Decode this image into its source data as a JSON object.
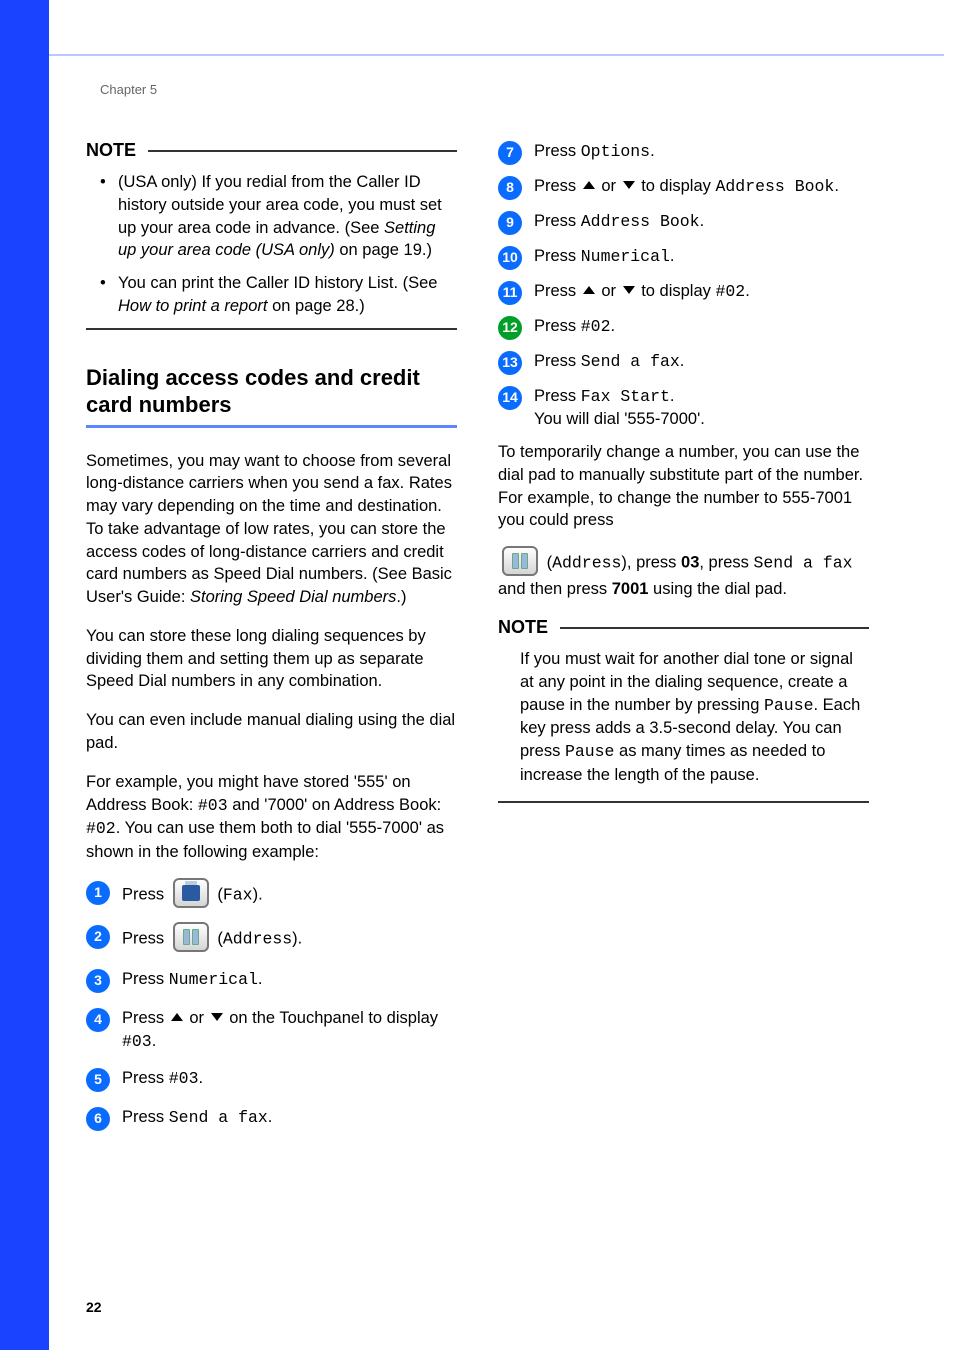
{
  "chapter": "Chapter 5",
  "page_number": "22",
  "note1_heading": "NOTE",
  "note1": {
    "a_pre": "(USA only) If you redial from the Caller ID history outside your area code, you must set up your area code in advance. (See ",
    "a_em": "Setting up your area code (USA only)",
    "a_post": " on page 19.)",
    "b_pre": "You can print the Caller ID history List. (See ",
    "b_em": "How to print a report",
    "b_post": " on page 28.)"
  },
  "section_title": "Dialing access codes and credit card numbers",
  "p1_pre": "Sometimes, you may want to choose from several long-distance carriers when you send a fax. Rates may vary depending on the time and destination. To take advantage of low rates, you can store the access codes of long-distance carriers and credit card numbers as Speed Dial numbers. (See Basic User's Guide: ",
  "p1_em": "Storing Speed Dial numbers",
  "p1_post": ".)",
  "p2": "You can store these long dialing sequences by dividing them and setting them up as separate Speed Dial numbers in any combination.",
  "p3": "You can even include manual dialing using the dial pad.",
  "p4_a": "For example, you might have stored '555' on Address Book: ",
  "p4_code1": "#03",
  "p4_b": " and '7000' on Address Book: ",
  "p4_code2": "#02",
  "p4_c": ". You can use them both to dial '555-7000' as shown in the following example:",
  "steps": {
    "s1_a": "Press ",
    "s1_b": " (",
    "s1_code": "Fax",
    "s1_c": ").",
    "s2_a": "Press ",
    "s2_b": " (",
    "s2_code": "Address",
    "s2_c": ").",
    "s3_a": "Press ",
    "s3_code": "Numerical",
    "s3_b": ".",
    "s4_a": "Press ",
    "s4_b": " or ",
    "s4_c": " on the Touchpanel to display ",
    "s4_code": "#03",
    "s4_d": ".",
    "s5_a": "Press ",
    "s5_code": "#03",
    "s5_b": ".",
    "s6_a": "Press ",
    "s6_code": "Send a fax",
    "s6_b": ".",
    "s7_a": "Press ",
    "s7_code": "Options",
    "s7_b": ".",
    "s8_a": "Press ",
    "s8_b": " or ",
    "s8_c": " to display ",
    "s8_code": "Address Book",
    "s8_d": ".",
    "s9_a": "Press ",
    "s9_code": "Address Book",
    "s9_b": ".",
    "s10_a": "Press ",
    "s10_code": "Numerical",
    "s10_b": ".",
    "s11_a": "Press ",
    "s11_b": " or ",
    "s11_c": " to display ",
    "s11_code": "#02",
    "s11_d": ".",
    "s12_a": "Press ",
    "s12_code": "#02",
    "s12_b": ".",
    "s13_a": "Press ",
    "s13_code": "Send a fax",
    "s13_b": ".",
    "s14_a": "Press ",
    "s14_code": "Fax Start",
    "s14_b": ".",
    "s14_line2": "You will dial '555-7000'."
  },
  "tail_p": "To temporarily change a number, you can use the dial pad to manually substitute part of the number. For example, to change the number to 555-7001 you could press",
  "tail2_a": " (",
  "tail2_code": "Address",
  "tail2_b": "), press ",
  "tail2_bold": "03",
  "tail2_c": ", press ",
  "tail2_code2": "Send a fax",
  "tail2_d": " and then press ",
  "tail2_bold2": "7001",
  "tail2_e": " using the dial pad.",
  "note2_heading": "NOTE",
  "note2_a": "If you must wait for another dial tone or signal at any point in the dialing sequence, create a pause in the number by pressing ",
  "note2_code1": "Pause",
  "note2_b": ". Each key press adds a 3.5-second delay. You can press ",
  "note2_code2": "Pause",
  "note2_c": " as many times as needed to increase the length of the pause."
}
